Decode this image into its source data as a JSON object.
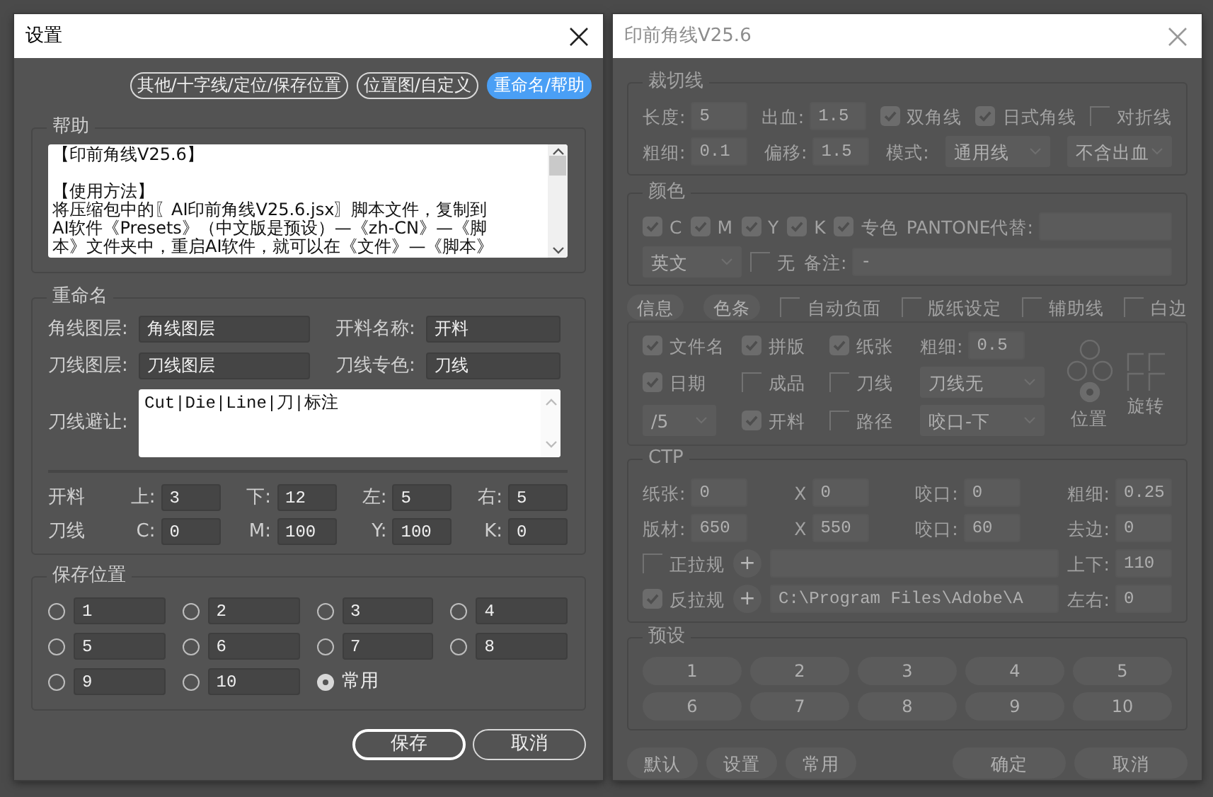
{
  "settings_dialog": {
    "title": "设置",
    "tabs": [
      {
        "label": "其他/十字线/定位/保存位置",
        "selected": false
      },
      {
        "label": "位置图/自定义",
        "selected": false
      },
      {
        "label": "重命名/帮助",
        "selected": true
      }
    ],
    "help": {
      "legend": "帮助",
      "paragraphs": [
        [
          "【印前角线V25.6】"
        ],
        [
          "【使用方法】",
          "将压缩包中的〖AI印前角线V25.6.jsx〗脚本文件，复制到",
          "AI软件《Presets》（中文版是预设）—《zh-CN》—《脚",
          "本》文件夹中，重启AI软件，就可以在《文件》—《脚本》"
        ]
      ]
    },
    "rename": {
      "legend": "重命名",
      "fields": [
        {
          "label": "角线图层:",
          "value": "角线图层"
        },
        {
          "label": "开料名称:",
          "value": "开料"
        },
        {
          "label": "刀线图层:",
          "value": "刀线图层"
        },
        {
          "label": "刀线专色:",
          "value": "刀线"
        }
      ],
      "avoid": {
        "label": "刀线避让:",
        "value": "Cut|Die|Line|刀|标注"
      },
      "offset_rows": [
        {
          "label": "开料",
          "fields": [
            {
              "label": "上:",
              "value": "3"
            },
            {
              "label": "下:",
              "value": "12"
            },
            {
              "label": "左:",
              "value": "5"
            },
            {
              "label": "右:",
              "value": "5"
            }
          ]
        },
        {
          "label": "刀线",
          "fields": [
            {
              "label": "C:",
              "value": "0"
            },
            {
              "label": "M:",
              "value": "100"
            },
            {
              "label": "Y:",
              "value": "100"
            },
            {
              "label": "K:",
              "value": "0"
            }
          ]
        }
      ]
    },
    "save_position": {
      "legend": "保存位置",
      "slots": [
        {
          "kind": "field",
          "value": "1",
          "selected": false
        },
        {
          "kind": "field",
          "value": "2",
          "selected": false
        },
        {
          "kind": "field",
          "value": "3",
          "selected": false
        },
        {
          "kind": "field",
          "value": "4",
          "selected": false
        },
        {
          "kind": "field",
          "value": "5",
          "selected": false
        },
        {
          "kind": "field",
          "value": "6",
          "selected": false
        },
        {
          "kind": "field",
          "value": "7",
          "selected": false
        },
        {
          "kind": "field",
          "value": "8",
          "selected": false
        },
        {
          "kind": "field",
          "value": "9",
          "selected": false
        },
        {
          "kind": "field",
          "value": "10",
          "selected": false
        },
        {
          "kind": "option",
          "label": "常用",
          "selected": true
        }
      ]
    },
    "buttons": [
      {
        "label": "保存",
        "default": true
      },
      {
        "label": "取消",
        "default": false
      }
    ]
  },
  "main_dialog": {
    "title": "印前角线V25.6",
    "dimmed": true,
    "sections": [
      {
        "kind": "fieldset",
        "legend": "裁切线",
        "lines": [
          {
            "items": [
              {
                "kind": "field",
                "label": "长度:",
                "value": "5"
              },
              {
                "kind": "field",
                "label": "出血:",
                "value": "1.5"
              },
              {
                "kind": "checkbox",
                "label": "双角线",
                "checked": true
              },
              {
                "kind": "checkbox",
                "label": "日式角线",
                "checked": true
              },
              {
                "kind": "checkbox",
                "label": "对折线",
                "checked": false
              }
            ]
          },
          {
            "items": [
              {
                "kind": "field",
                "label": "粗细:",
                "value": "0.1"
              },
              {
                "kind": "field",
                "label": "偏移:",
                "value": "1.5"
              },
              {
                "kind": "label",
                "label": "模式:"
              },
              {
                "kind": "dropdown",
                "value": "通用线"
              },
              {
                "kind": "dropdown",
                "value": "不含出血"
              }
            ]
          }
        ]
      },
      {
        "kind": "fieldset",
        "legend": "颜色",
        "lines": [
          {
            "items": [
              {
                "kind": "checkbox",
                "label": "C",
                "checked": true
              },
              {
                "kind": "checkbox",
                "label": "M",
                "checked": true
              },
              {
                "kind": "checkbox",
                "label": "Y",
                "checked": true
              },
              {
                "kind": "checkbox",
                "label": "K",
                "checked": true
              },
              {
                "kind": "checkbox",
                "label": "专色",
                "checked": true
              },
              {
                "kind": "textfield",
                "label": "PANTONE代替:"
              }
            ]
          },
          {
            "items": [
              {
                "kind": "dropdown",
                "value": "英文"
              },
              {
                "kind": "checkbox",
                "label": "无",
                "checked": false
              },
              {
                "kind": "textfield",
                "label": "备注:",
                "value": "-"
              }
            ]
          }
        ]
      },
      {
        "kind": "toolbar",
        "lines": [
          {
            "items": [
              {
                "kind": "pill",
                "label": "信息"
              },
              {
                "kind": "pill",
                "label": "色条"
              },
              {
                "kind": "checkbox",
                "label": "自动负面",
                "checked": false
              },
              {
                "kind": "checkbox",
                "label": "版纸设定",
                "checked": false
              },
              {
                "kind": "checkbox",
                "label": "辅助线",
                "checked": false
              },
              {
                "kind": "checkbox",
                "label": "白边",
                "checked": false
              }
            ]
          }
        ]
      },
      {
        "kind": "panel",
        "lines": [
          {
            "items": [
              {
                "kind": "checkbox",
                "label": "文件名",
                "checked": true
              },
              {
                "kind": "checkbox",
                "label": "拼版",
                "checked": true
              },
              {
                "kind": "checkbox",
                "label": "纸张",
                "checked": true
              },
              {
                "kind": "field",
                "label": "粗细:",
                "value": "0.5"
              }
            ]
          },
          {
            "items": [
              {
                "kind": "checkbox",
                "label": "日期",
                "checked": true
              },
              {
                "kind": "checkbox",
                "label": "成品",
                "checked": false
              },
              {
                "kind": "checkbox",
                "label": "刀线",
                "checked": false
              },
              {
                "kind": "dropdown",
                "value": "刀线无"
              }
            ]
          },
          {
            "items": [
              {
                "kind": "dropdown",
                "value": "/5"
              },
              {
                "kind": "checkbox",
                "label": "开料",
                "checked": true
              },
              {
                "kind": "checkbox",
                "label": "路径",
                "checked": false
              },
              {
                "kind": "dropdown",
                "value": "咬口-下"
              }
            ]
          }
        ],
        "position": {
          "label": "位置",
          "anchors": [
            {
              "selected": false
            },
            {
              "selected": false
            },
            {
              "selected": false
            },
            {
              "selected": true
            }
          ]
        },
        "rotate": {
          "label": "旋转"
        }
      },
      {
        "kind": "fieldset",
        "legend": "CTP",
        "lines": [
          {
            "items": [
              {
                "kind": "field",
                "label": "纸张:",
                "value": "0"
              },
              {
                "kind": "field",
                "label": "X",
                "value": "0"
              },
              {
                "kind": "field",
                "label": "咬口:",
                "value": "0"
              },
              {
                "kind": "field",
                "label": "粗细:",
                "value": "0.25"
              }
            ]
          },
          {
            "items": [
              {
                "kind": "field",
                "label": "版材:",
                "value": "650"
              },
              {
                "kind": "field",
                "label": "X",
                "value": "550"
              },
              {
                "kind": "field",
                "label": "咬口:",
                "value": "60"
              },
              {
                "kind": "field",
                "label": "去边:",
                "value": "0"
              }
            ]
          },
          {
            "items": [
              {
                "kind": "checkbox",
                "label": "正拉规",
                "checked": false
              },
              {
                "kind": "plus",
                "label": "+"
              },
              {
                "kind": "textfield"
              },
              {
                "kind": "field",
                "label": "上下:",
                "value": "110"
              }
            ]
          },
          {
            "items": [
              {
                "kind": "checkbox",
                "label": "反拉规",
                "checked": true
              },
              {
                "kind": "plus",
                "label": "+"
              },
              {
                "kind": "textfield",
                "value": "C:\\Program Files\\Adobe\\A"
              },
              {
                "kind": "field",
                "label": "左右:",
                "value": "0"
              }
            ]
          }
        ]
      },
      {
        "kind": "fieldset",
        "legend": "预设",
        "lines": [
          {
            "items": [
              {
                "kind": "preset",
                "label": "1"
              },
              {
                "kind": "preset",
                "label": "2"
              },
              {
                "kind": "preset",
                "label": "3"
              },
              {
                "kind": "preset",
                "label": "4"
              },
              {
                "kind": "preset",
                "label": "5"
              }
            ]
          },
          {
            "items": [
              {
                "kind": "preset",
                "label": "6"
              },
              {
                "kind": "preset",
                "label": "7"
              },
              {
                "kind": "preset",
                "label": "8"
              },
              {
                "kind": "preset",
                "label": "9"
              },
              {
                "kind": "preset",
                "label": "10"
              }
            ]
          }
        ]
      }
    ],
    "footer_left": [
      {
        "label": "默认"
      },
      {
        "label": "设置"
      },
      {
        "label": "常用"
      }
    ],
    "footer_right": [
      {
        "label": "确定"
      },
      {
        "label": "取消"
      }
    ]
  }
}
